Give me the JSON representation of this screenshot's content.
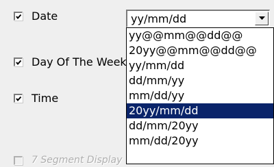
{
  "options": [
    {
      "label": "Date",
      "checked": true,
      "enabled": true
    },
    {
      "label": "Day Of The Week",
      "checked": true,
      "enabled": true
    },
    {
      "label": "Time",
      "checked": true,
      "enabled": true
    },
    {
      "label": "7 Segment Display",
      "checked": false,
      "enabled": false
    }
  ],
  "date_format": {
    "value": "yy/mm/dd",
    "dropdown_icon": "chevron-down-icon",
    "items": [
      "yy@@mm@@dd@@",
      "20yy@@mm@@dd@@",
      "yy/mm/dd",
      "dd/mm/yy",
      "mm/dd/yy",
      "20yy/mm/dd",
      "dd/mm/20yy",
      "mm/dd/20yy"
    ],
    "selected_item": "20yy/mm/dd"
  },
  "colors": {
    "selection_background": "#0a246a",
    "selection_text": "#ffffff",
    "window_background": "#efefef"
  }
}
